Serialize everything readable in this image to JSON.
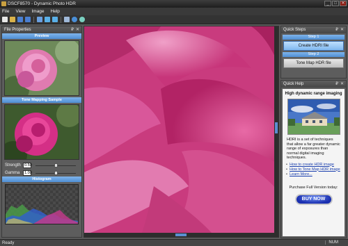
{
  "window": {
    "title": "DSCF8570 - Dynamic Photo HDR",
    "min_glyph": "_",
    "max_glyph": "□",
    "close_glyph": "✕"
  },
  "menu": [
    "File",
    "View",
    "Image",
    "Help"
  ],
  "toolbar": {
    "icons": [
      {
        "name": "new-icon",
        "color": "#e8e8e8"
      },
      {
        "name": "open-icon",
        "color": "#d9b24a"
      },
      {
        "name": "save-icon",
        "color": "#4a7fd1"
      },
      {
        "name": "save-as-icon",
        "color": "#4a7fd1"
      },
      {
        "name": "hdr-icon",
        "color": "#6aa0e0"
      },
      {
        "name": "undo-icon",
        "color": "#5ab0e8"
      },
      {
        "name": "redo-icon",
        "color": "#5ab0e8"
      },
      {
        "name": "zoom-icon",
        "color": "#9fb9d9"
      },
      {
        "name": "help-icon",
        "color": "#4a8fd8"
      },
      {
        "name": "settings-icon",
        "color": "#7ad0c0"
      }
    ]
  },
  "file_properties": {
    "title": "File Properties",
    "pin_glyph": "₽",
    "close_glyph": "✕",
    "preview_label": "Preview",
    "tone_label": "Tone Mapping Sample",
    "strength": {
      "label": "Strength",
      "value": "0.50",
      "level": 0.5
    },
    "gamma": {
      "label": "Gamma",
      "value": "1.00",
      "level": 0.5
    },
    "histogram_label": "Histogram"
  },
  "quick_steps": {
    "title": "Quick Steps",
    "pin_glyph": "₽",
    "close_glyph": "✕",
    "step1": "Step 1",
    "create_button": "Create HDRI file",
    "step2": "Step 2",
    "tonemap_button": "Tone Map HDR file"
  },
  "quick_help": {
    "title": "Quick Help",
    "pin_glyph": "₽",
    "close_glyph": "✕",
    "heading": "High dynamic range imaging",
    "text": "HDRI is a set of techniques that allow a far greater dynamic range of exposures than normal digital imaging techniques.",
    "links": [
      "How to create HDR image",
      "How to Tone Map HDR image",
      "Learn More..."
    ],
    "purchase": "Purchase Full Version today:",
    "buy_button": "BUY NOW"
  },
  "status": {
    "ready": "Ready",
    "num": "NUM"
  }
}
